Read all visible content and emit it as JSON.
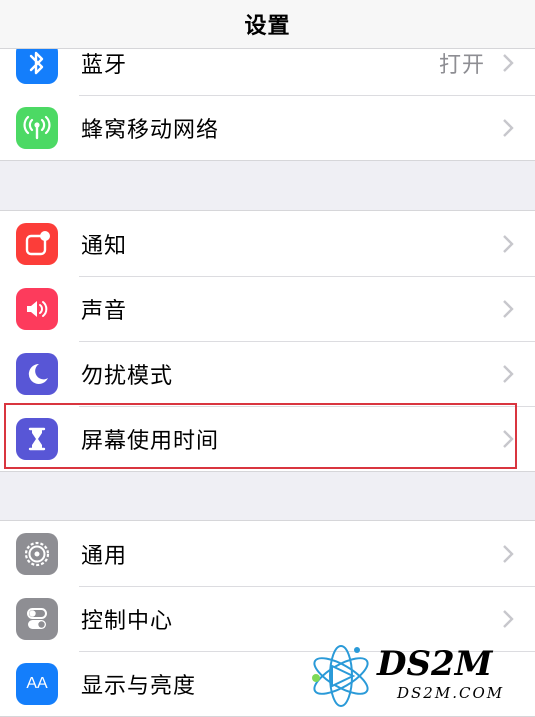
{
  "nav": {
    "title": "设置"
  },
  "groups": [
    {
      "items": [
        {
          "label": "蓝牙",
          "value": "打开",
          "icon": "bluetooth-icon",
          "color": "#147efb"
        },
        {
          "label": "蜂窝移动网络",
          "value": "",
          "icon": "cellular-icon",
          "color": "#4cd964"
        }
      ]
    },
    {
      "items": [
        {
          "label": "通知",
          "value": "",
          "icon": "notifications-icon",
          "color": "#fc3d39"
        },
        {
          "label": "声音",
          "value": "",
          "icon": "sounds-icon",
          "color": "#fd3b5c"
        },
        {
          "label": "勿扰模式",
          "value": "",
          "icon": "moon-icon",
          "color": "#5856d6"
        },
        {
          "label": "屏幕使用时间",
          "value": "",
          "icon": "hourglass-icon",
          "color": "#5856d6"
        }
      ]
    },
    {
      "items": [
        {
          "label": "通用",
          "value": "",
          "icon": "gear-icon",
          "color": "#8e8e93"
        },
        {
          "label": "控制中心",
          "value": "",
          "icon": "toggles-icon",
          "color": "#8e8e93"
        },
        {
          "label": "显示与亮度",
          "value": "",
          "icon": "display-icon",
          "color": "#147efb",
          "glyph": "AA"
        }
      ]
    }
  ],
  "watermark": {
    "text": "DS2M",
    "url": "DS2M.COM"
  }
}
